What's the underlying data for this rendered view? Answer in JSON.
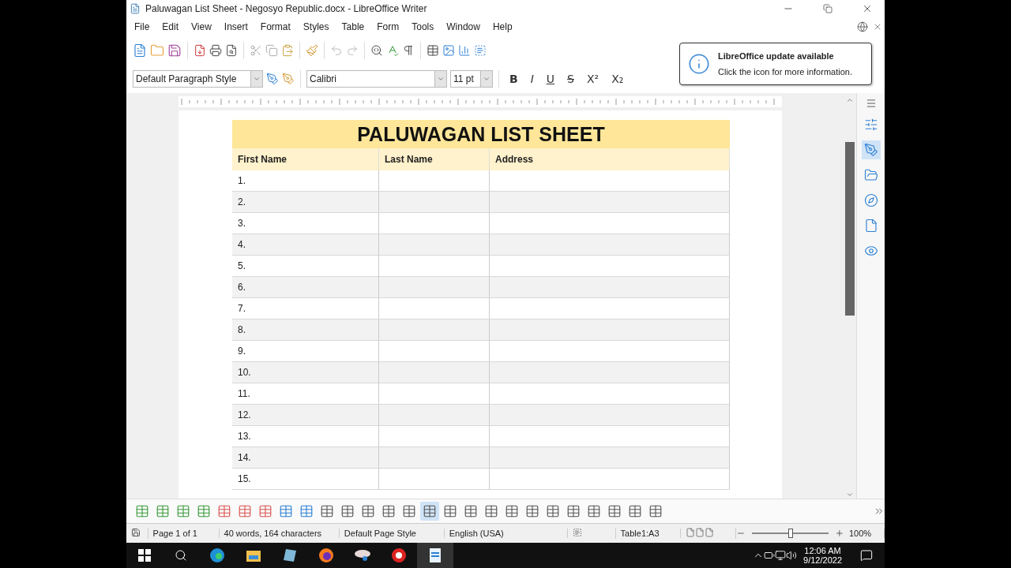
{
  "window": {
    "title": "Paluwagan List Sheet - Negosyo Republic.docx - LibreOffice Writer"
  },
  "menu": [
    "File",
    "Edit",
    "View",
    "Insert",
    "Format",
    "Styles",
    "Table",
    "Form",
    "Tools",
    "Window",
    "Help"
  ],
  "format_bar": {
    "paragraph_style": "Default Paragraph Style",
    "font_name": "Calibri",
    "font_size": "11 pt",
    "buttons": [
      "B",
      "I",
      "U",
      "S",
      "X²",
      "X₂"
    ]
  },
  "notification": {
    "title": "LibreOffice update available",
    "message": "Click the icon for more information."
  },
  "document": {
    "table": {
      "title": "PALUWAGAN LIST SHEET",
      "columns": [
        "First Name",
        "Last Name",
        "Address"
      ],
      "rows": [
        "1.",
        "2.",
        "3.",
        "4.",
        "5.",
        "6.",
        "7.",
        "8.",
        "9.",
        "10.",
        "11.",
        "12.",
        "13.",
        "14.",
        "15."
      ]
    }
  },
  "sidebar_tabs": [
    {
      "kind": "properties",
      "selected": false
    },
    {
      "kind": "styles",
      "selected": true
    },
    {
      "kind": "gallery",
      "selected": false
    },
    {
      "kind": "navigator",
      "selected": false
    },
    {
      "kind": "page",
      "selected": false
    },
    {
      "kind": "inspector",
      "selected": false
    }
  ],
  "table_toolbar": [
    {
      "kind": "row-above",
      "selected": false
    },
    {
      "kind": "row-below",
      "selected": false
    },
    {
      "kind": "col-before",
      "selected": false
    },
    {
      "kind": "col-after",
      "selected": false
    },
    {
      "kind": "del-row",
      "selected": false
    },
    {
      "kind": "del-col",
      "selected": false
    },
    {
      "kind": "del-table",
      "selected": false
    },
    {
      "kind": "select-cell",
      "selected": false
    },
    {
      "kind": "select-table",
      "selected": false
    },
    {
      "kind": "merge",
      "selected": false
    },
    {
      "kind": "split",
      "selected": false
    },
    {
      "kind": "split-table",
      "selected": false
    },
    {
      "kind": "protect",
      "selected": false
    },
    {
      "kind": "align-top",
      "selected": false
    },
    {
      "kind": "align-center",
      "selected": true
    },
    {
      "kind": "align-bottom",
      "selected": false
    },
    {
      "kind": "fill",
      "selected": false
    },
    {
      "kind": "autoformat",
      "selected": false
    },
    {
      "kind": "borders",
      "selected": false
    },
    {
      "kind": "border-style",
      "selected": false
    },
    {
      "kind": "border-color",
      "selected": false
    },
    {
      "kind": "number-format",
      "selected": false
    },
    {
      "kind": "percent",
      "selected": false
    },
    {
      "kind": "decimal",
      "selected": false
    },
    {
      "kind": "properties",
      "selected": false
    },
    {
      "kind": "table-props",
      "selected": false
    }
  ],
  "status_bar": {
    "page": "Page 1 of 1",
    "words": "40 words, 164 characters",
    "page_style": "Default Page Style",
    "language": "English (USA)",
    "cell": "Table1:A3",
    "zoom": {
      "level": 0.5,
      "reading": "100%"
    }
  },
  "taskbar": {
    "time": "12:06 AM",
    "date": "9/12/2022"
  }
}
